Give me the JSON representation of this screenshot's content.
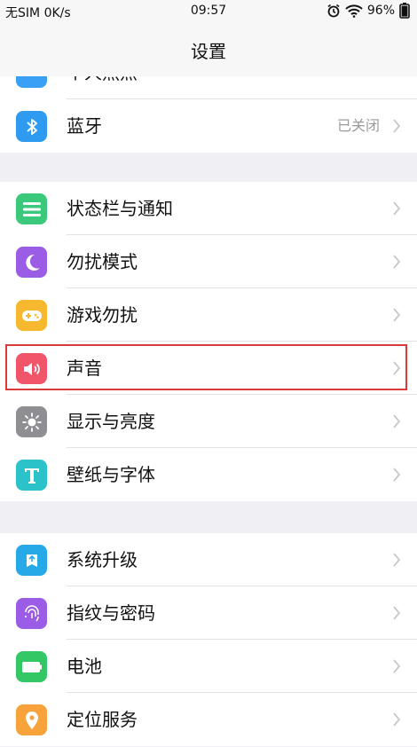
{
  "status_bar": {
    "carrier": "无SIM",
    "speed": "0K/s",
    "time": "09:57",
    "battery": "96%"
  },
  "header": {
    "title": "设置"
  },
  "partial_item": {
    "label": "个人热点",
    "icon": "hotspot-icon",
    "color": "#3aa0f5"
  },
  "groups": [
    {
      "items": [
        {
          "label": "蓝牙",
          "value": "已关闭",
          "icon": "bluetooth-icon",
          "color": "#2f9bf0"
        }
      ]
    },
    {
      "items": [
        {
          "label": "状态栏与通知",
          "icon": "notification-icon",
          "color": "#3ac97a"
        },
        {
          "label": "勿扰模式",
          "icon": "moon-icon",
          "color": "#9b5de5"
        },
        {
          "label": "游戏勿扰",
          "icon": "gamepad-icon",
          "color": "#f5b82e"
        },
        {
          "label": "声音",
          "icon": "speaker-icon",
          "color": "#f0556a"
        },
        {
          "label": "显示与亮度",
          "icon": "brightness-icon",
          "color": "#8e8e93"
        },
        {
          "label": "壁纸与字体",
          "icon": "font-icon",
          "color": "#2bc3c9"
        }
      ]
    },
    {
      "items": [
        {
          "label": "系统升级",
          "icon": "system-update-icon",
          "color": "#27a9e8"
        },
        {
          "label": "指纹与密码",
          "icon": "fingerprint-icon",
          "color": "#9b5de5"
        },
        {
          "label": "电池",
          "icon": "battery-icon",
          "color": "#34c766"
        },
        {
          "label": "定位服务",
          "icon": "location-icon",
          "color": "#f7a23a"
        }
      ]
    }
  ]
}
